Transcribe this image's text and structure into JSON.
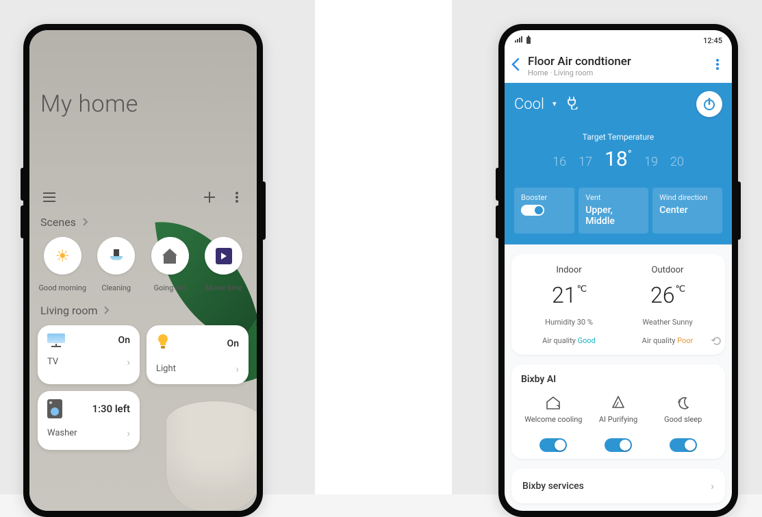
{
  "status": {
    "time": "12:45"
  },
  "left": {
    "title": "My home",
    "sections": {
      "scenes_label": "Scenes",
      "living_label": "Living room"
    },
    "scenes": [
      {
        "label": "Good morning"
      },
      {
        "label": "Cleaning"
      },
      {
        "label": "Going out"
      },
      {
        "label": "Movie time"
      }
    ],
    "devices": {
      "tv": {
        "name": "TV",
        "state": "On"
      },
      "light": {
        "name": "Light",
        "state": "On"
      },
      "washer": {
        "name": "Washer",
        "time": "1:30 left"
      }
    }
  },
  "right": {
    "header": {
      "title": "Floor Air condtioner",
      "subtitle": "Home · Living room"
    },
    "mode": "Cool",
    "target_label": "Target Temperature",
    "temps": {
      "t1": "16",
      "t2": "17",
      "t3": "18",
      "t4": "19",
      "t5": "20"
    },
    "tiles": {
      "booster": {
        "label": "Booster",
        "on": true
      },
      "vent": {
        "label": "Vent",
        "value": "Upper, Middle"
      },
      "wind": {
        "label": "Wind direction",
        "value": "Center"
      }
    },
    "env": {
      "indoor": {
        "label": "Indoor",
        "temp": "21",
        "humidity_label": "Humidity 30 %",
        "aq_label": "Air quality ",
        "aq_value": "Good"
      },
      "outdoor": {
        "label": "Outdoor",
        "temp": "26",
        "weather_label": "Weather Sunny",
        "aq_label": "Air quality ",
        "aq_value": "Poor"
      }
    },
    "bixby": {
      "title": "Bixby AI",
      "items": [
        {
          "label": "Welcome cooling"
        },
        {
          "label": "AI Purifying"
        },
        {
          "label": "Good sleep"
        }
      ],
      "services_label": "Bixby services"
    }
  }
}
